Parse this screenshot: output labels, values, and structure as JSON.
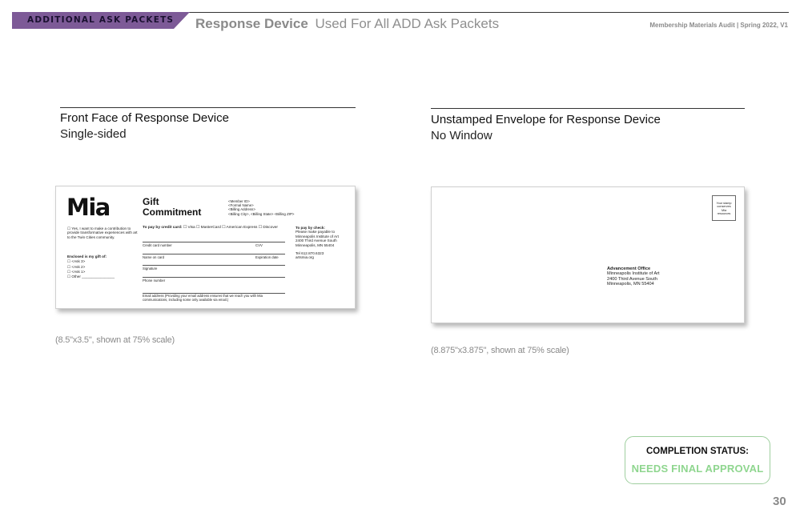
{
  "header": {
    "section_tab": "ADDITIONAL ASK PACKETS",
    "title_strong": "Response Device",
    "title_light": "Used For All ADD Ask Packets",
    "meta": "Membership Materials Audit | Spring 2022, V1"
  },
  "left_panel": {
    "title": "Front Face of Response Device",
    "subtitle": "Single-sided",
    "caption": "(8.5\"x3.5\", shown at 75% scale)"
  },
  "right_panel": {
    "title": "Unstamped Envelope for Response Device",
    "subtitle": "No Window",
    "caption": "(8.875\"x3.875\", shown at 75% scale)"
  },
  "response_card": {
    "logo": "Mia",
    "gift_title": "Gift Commitment",
    "addr_lines": [
      "<Member ID>",
      "<Formal Name>",
      "<Billing Address>",
      "<Billing City>, <Billing State> <Billing ZIP>"
    ],
    "yes_text": "☐ Yes, I want to make a contribution to provide transformative experiences with art to the Twin Cities community.",
    "enclosed_head": "Enclosed is my gift of:",
    "enclosed_options": [
      "☐ <Ask 3>",
      "☐ <Ask 2>",
      "☐ <Ask 1>",
      "☐ Other ________________"
    ],
    "pay_cc_head": "To pay by credit card:",
    "pay_cc_options": "☐ Visa  ☐ MasterCard  ☐ American Express  ☐ Discover",
    "field_card_number": "Credit card number",
    "field_cvv": "CVV",
    "field_name": "Name on card",
    "field_expiration": "Expiration date",
    "field_signature": "Signature",
    "field_phone": "Phone number",
    "email_label": "Email address",
    "email_note": "(Providing your email address ensures that we reach you with Mia communications, including some only available via email.)",
    "check_head": "To pay by check:",
    "check_lines": [
      "Please make payable to",
      "Minneapolis Institute of Art",
      "2400 Third Avenue South",
      "Minneapolis, MN  55404"
    ],
    "tel": "Tel 612.870.6323",
    "web": "artsmia.org"
  },
  "envelope": {
    "stamp_text": [
      "Your stamp",
      "conserves",
      "Mia",
      "resources"
    ],
    "address_head": "Advancement Office",
    "address_lines": [
      "Minneapolis Institute of Art",
      "2400 Third Avenue South",
      "Minneapolis, MN  55404"
    ]
  },
  "status": {
    "label": "COMPLETION STATUS:",
    "value": "NEEDS FINAL APPROVAL",
    "color": "#8fd68f",
    "border_color": "#9fcf9f"
  },
  "section_color": "#7d5a97",
  "page_number": "30"
}
